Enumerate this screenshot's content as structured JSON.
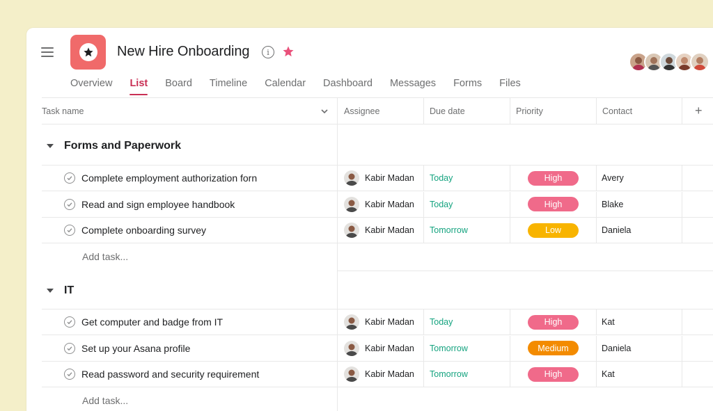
{
  "project": {
    "title": "New Hire Onboarding",
    "icon": "star-icon",
    "color": "#f06a6a",
    "favorite_color": "#e9507a"
  },
  "tabs": [
    "Overview",
    "List",
    "Board",
    "Timeline",
    "Calendar",
    "Dashboard",
    "Messages",
    "Forms",
    "Files"
  ],
  "active_tab": "List",
  "columns": {
    "task": "Task name",
    "assignee": "Assignee",
    "due": "Due date",
    "priority": "Priority",
    "contact": "Contact",
    "add": "+"
  },
  "sections": [
    {
      "title": "Forms and Paperwork",
      "tasks": [
        {
          "name": "Complete employment authorization forn",
          "assignee": "Kabir Madan",
          "due": "Today",
          "priority": "High",
          "contact": "Avery"
        },
        {
          "name": "Read and sign employee handbook",
          "assignee": "Kabir Madan",
          "due": "Today",
          "priority": "High",
          "contact": "Blake"
        },
        {
          "name": "Complete onboarding survey",
          "assignee": "Kabir Madan",
          "due": "Tomorrow",
          "priority": "Low",
          "contact": "Daniela"
        }
      ],
      "add_label": "Add task..."
    },
    {
      "title": "IT",
      "tasks": [
        {
          "name": "Get computer and badge from IT",
          "assignee": "Kabir Madan",
          "due": "Today",
          "priority": "High",
          "contact": "Kat"
        },
        {
          "name": "Set up your Asana profile",
          "assignee": "Kabir Madan",
          "due": "Tomorrow",
          "priority": "Medium",
          "contact": "Daniela"
        },
        {
          "name": "Read password and security requirement",
          "assignee": "Kabir Madan",
          "due": "Tomorrow",
          "priority": "High",
          "contact": "Kat"
        }
      ],
      "add_label": "Add task..."
    }
  ],
  "priority_colors": {
    "High": "#f06a8a",
    "Low": "#f8b400",
    "Medium": "#f38b00"
  },
  "due_color": "#14a37f"
}
